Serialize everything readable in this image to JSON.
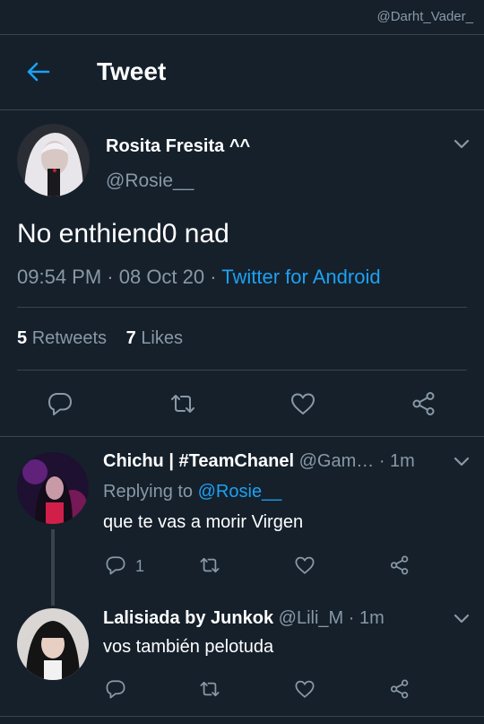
{
  "status_bar": {
    "watermark": "@Darht_Vader_"
  },
  "header": {
    "title": "Tweet"
  },
  "tweet": {
    "author_name": "Rosita Fresita ^^",
    "handle": "@Rosie__",
    "text": "No enthiend0 nad",
    "time": "09:54 PM",
    "date": "08 Oct 20",
    "source": "Twitter for Android",
    "retweets_count": "5",
    "retweets_label": "Retweets",
    "likes_count": "7",
    "likes_label": "Likes"
  },
  "replies": [
    {
      "author_name": "Chichu | #TeamChanel",
      "handle": "@Gam…",
      "time": "1m",
      "replying_label": "Replying to",
      "replying_to": "@Rosie__",
      "text": "que te vas a morir Virgen",
      "reply_count": "1"
    },
    {
      "author_name": "Lalisiada by Junkok",
      "handle": "@Lili_M",
      "time": "1m",
      "text": "vos también pelotuda"
    }
  ],
  "icons": [
    "back-arrow-icon",
    "chevron-down-icon",
    "reply-icon",
    "retweet-icon",
    "like-icon",
    "share-icon"
  ],
  "colors": {
    "background": "#15202b",
    "accent": "#1da1f2",
    "muted": "#8899a6",
    "divider": "#38444d"
  }
}
